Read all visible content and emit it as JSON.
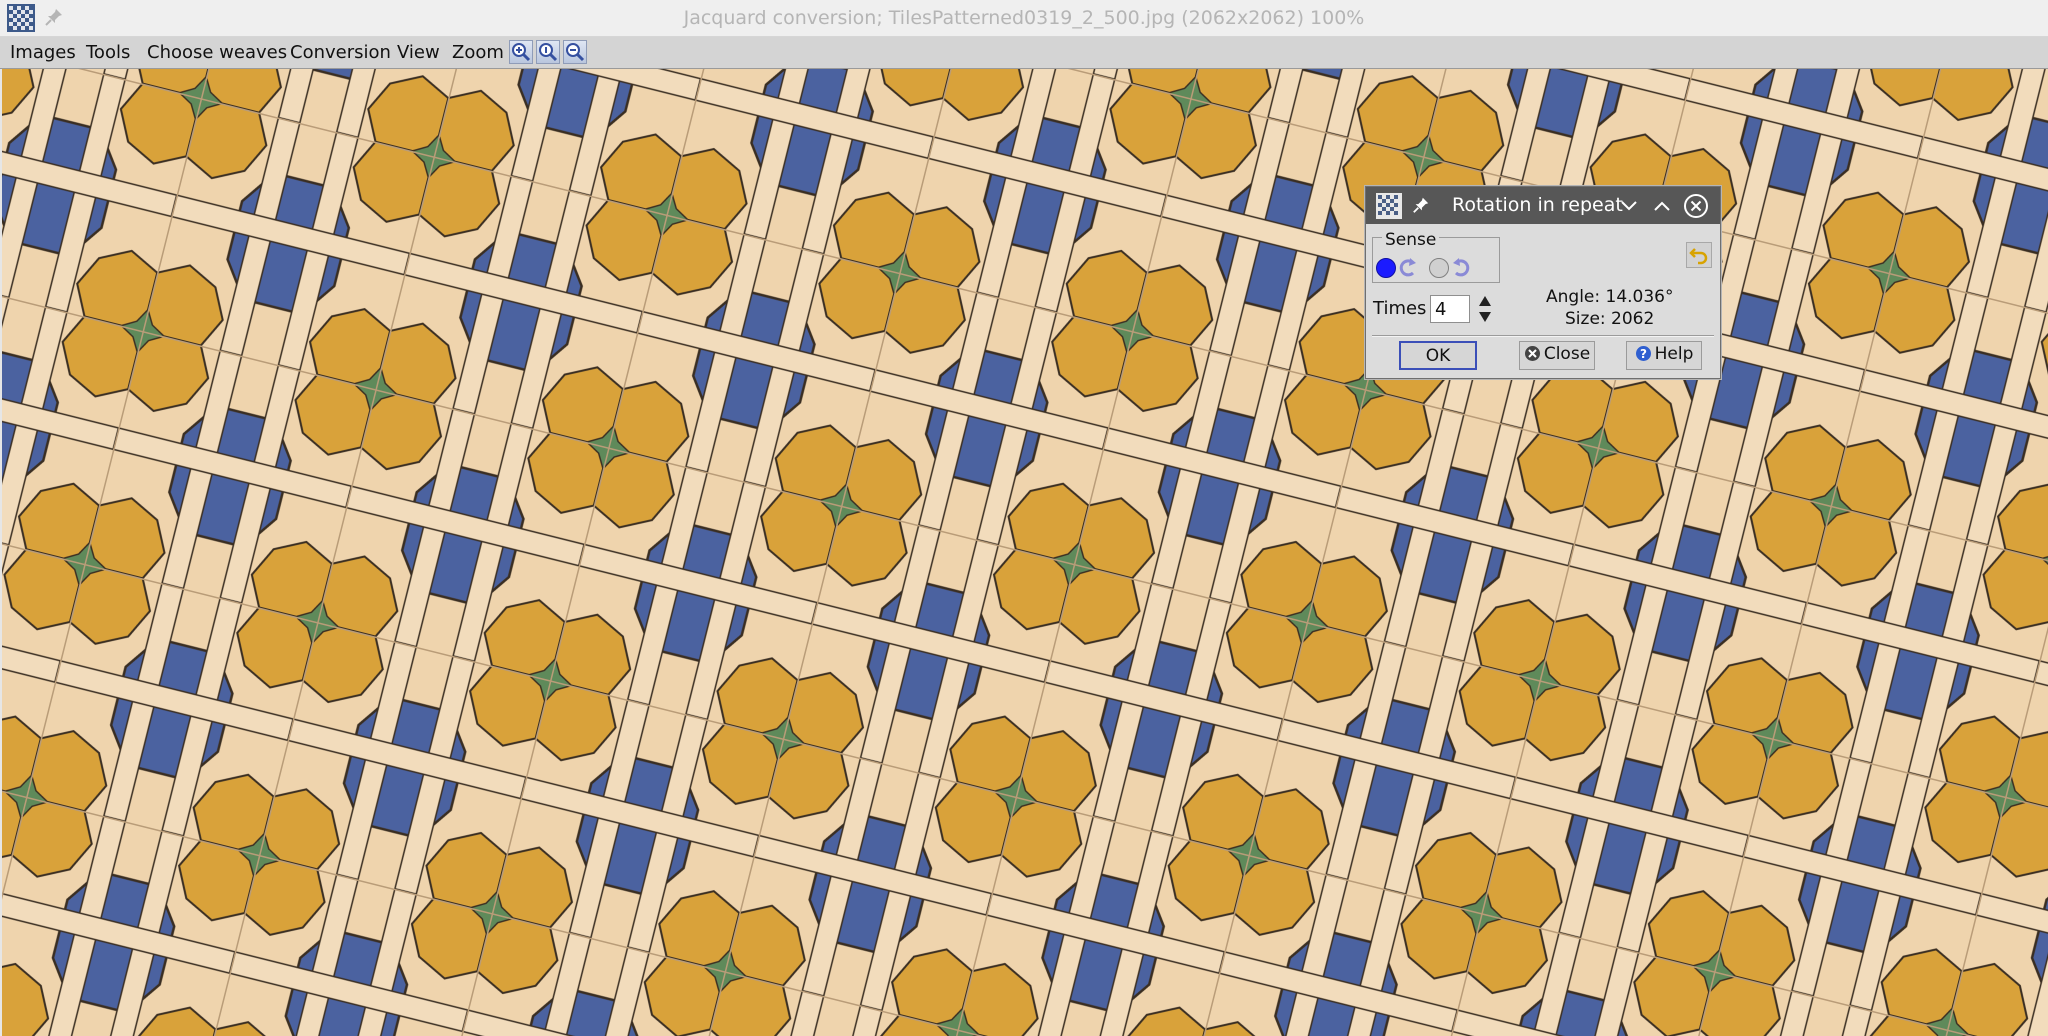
{
  "window": {
    "title": "Jacquard conversion; TilesPatterned0319_2_500.jpg (2062x2062) 100%"
  },
  "menubar": {
    "items": [
      "Images",
      "Tools",
      "Choose weaves",
      "Conversion",
      "View",
      "Zoom"
    ],
    "zoom_buttons": [
      "zoom-in-icon",
      "zoom-actual-icon",
      "zoom-out-icon"
    ]
  },
  "canvas": {
    "description_colors": {
      "background": "#efd4ad",
      "blue": "#4b62a0",
      "orange": "#d9a23a",
      "green": "#5f8a5a",
      "outline": "#3a2e22"
    }
  },
  "dialog": {
    "title": "Rotation in repeat",
    "sense_label": "Sense",
    "sense_options": [
      {
        "icon": "radio-selected",
        "selected": true
      },
      {
        "icon": "rotate-ccw-icon",
        "selected": false
      },
      {
        "icon": "radio-unselected",
        "selected": false
      },
      {
        "icon": "rotate-cw-icon",
        "selected": false
      }
    ],
    "times_label": "Times",
    "times_value": "4",
    "angle_text": "Angle: 14.036°",
    "size_text": "Size: 2062",
    "buttons": {
      "ok": "OK",
      "close": "Close",
      "help": "Help"
    },
    "colors": {
      "titlebar": "#575757",
      "accent": "#3b4fb8"
    }
  }
}
